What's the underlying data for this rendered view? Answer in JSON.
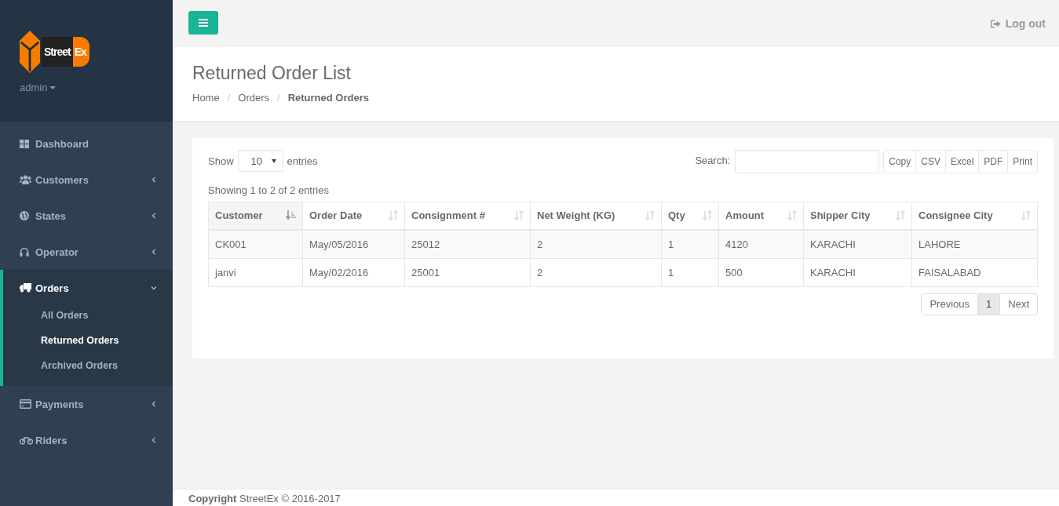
{
  "logo": {
    "word_1": "Street",
    "word_2": "Ex"
  },
  "user": {
    "name": "admin"
  },
  "sidebar": {
    "items": [
      {
        "kind": "grid",
        "label": "Dashboard",
        "has_submenu": false,
        "selected": false
      },
      {
        "kind": "users",
        "label": "Customers",
        "has_submenu": true,
        "expanded": false,
        "selected": false
      },
      {
        "kind": "globe",
        "label": "States",
        "has_submenu": true,
        "expanded": false,
        "selected": false
      },
      {
        "kind": "headset",
        "label": "Operator",
        "has_submenu": true,
        "expanded": false,
        "selected": false
      },
      {
        "kind": "truck",
        "label": "Orders",
        "has_submenu": true,
        "expanded": true,
        "selected": true,
        "children": [
          {
            "label": "All Orders",
            "selected": false
          },
          {
            "label": "Returned Orders",
            "selected": true
          },
          {
            "label": "Archived Orders",
            "selected": false
          }
        ]
      },
      {
        "kind": "card",
        "label": "Payments",
        "has_submenu": true,
        "expanded": false,
        "selected": false
      },
      {
        "kind": "bike",
        "label": "Riders",
        "has_submenu": true,
        "expanded": false,
        "selected": false
      }
    ]
  },
  "topbar": {
    "logout": "Log out"
  },
  "page": {
    "title": "Returned Order List",
    "breadcrumb_separator": "/",
    "breadcrumb": [
      {
        "label": "Home",
        "current": false
      },
      {
        "label": "Orders",
        "current": false
      },
      {
        "label": "Returned Orders",
        "current": true
      }
    ]
  },
  "table_controls": {
    "show_label": "Show",
    "page_size": "10",
    "entries_label": "entries",
    "search_label": "Search:",
    "export_buttons": [
      "Copy",
      "CSV",
      "Excel",
      "PDF",
      "Print"
    ],
    "info": "Showing 1 to 2 of 2 entries"
  },
  "table": {
    "columns": [
      {
        "label": "Customer",
        "sorted": true
      },
      {
        "label": "Order Date",
        "sorted": false
      },
      {
        "label": "Consignment #",
        "sorted": false
      },
      {
        "label": "Net Weight (KG)",
        "sorted": false
      },
      {
        "label": "Qty",
        "sorted": false
      },
      {
        "label": "Amount",
        "sorted": false
      },
      {
        "label": "Shipper City",
        "sorted": false
      },
      {
        "label": "Consignee City",
        "sorted": false
      }
    ],
    "rows": [
      [
        "CK001",
        "May/05/2016",
        "25012",
        "2",
        "1",
        "4120",
        "KARACHI",
        "LAHORE"
      ],
      [
        "janvi",
        "May/02/2016",
        "25001",
        "2",
        "1",
        "500",
        "KARACHI",
        "FAISALABAD"
      ]
    ]
  },
  "pagination": {
    "previous": "Previous",
    "pages": [
      {
        "label": "1",
        "selected": true
      }
    ],
    "next": "Next"
  },
  "footer": {
    "text": "**Copyright** StreetEx © 2016-2017"
  }
}
